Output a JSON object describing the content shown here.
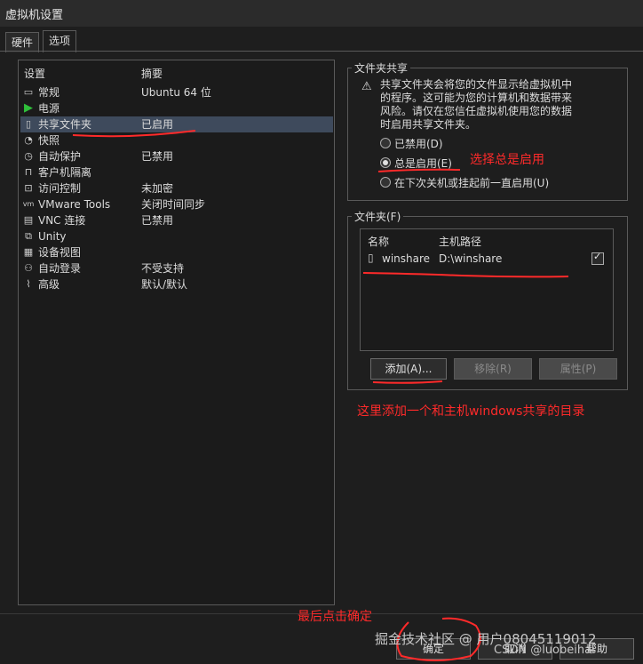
{
  "window": {
    "title": "虚拟机设置"
  },
  "tabs": [
    {
      "label": "硬件"
    },
    {
      "label": "选项"
    }
  ],
  "settings": {
    "col_setting": "设置",
    "col_summary": "摘要",
    "items": [
      {
        "name": "常规",
        "value": "Ubuntu 64 位",
        "icon": "monitor-icon"
      },
      {
        "name": "电源",
        "value": "",
        "icon": "power-play-icon"
      },
      {
        "name": "共享文件夹",
        "value": "已启用",
        "icon": "shared-folder-icon"
      },
      {
        "name": "快照",
        "value": "",
        "icon": "snapshot-icon"
      },
      {
        "name": "自动保护",
        "value": "已禁用",
        "icon": "autoprotect-clock-icon"
      },
      {
        "name": "客户机隔离",
        "value": "",
        "icon": "lock-icon"
      },
      {
        "name": "访问控制",
        "value": "未加密",
        "icon": "access-control-icon"
      },
      {
        "name": "VMware Tools",
        "value": "关闭时间同步",
        "icon": "vmware-tools-icon"
      },
      {
        "name": "VNC 连接",
        "value": "已禁用",
        "icon": "vnc-icon"
      },
      {
        "name": "Unity",
        "value": "",
        "icon": "unity-icon"
      },
      {
        "name": "设备视图",
        "value": "",
        "icon": "device-view-icon"
      },
      {
        "name": "自动登录",
        "value": "不受支持",
        "icon": "autologin-users-icon"
      },
      {
        "name": "高级",
        "value": "默认/默认",
        "icon": "advanced-pulse-icon"
      }
    ]
  },
  "folder_sharing": {
    "title": "文件夹共享",
    "warning_lines": [
      "共享文件夹会将您的文件显示给虚拟机中",
      "的程序。这可能为您的计算机和数据带来",
      "风险。请仅在您信任虚拟机使用您的数据",
      "时启用共享文件夹。"
    ],
    "options": [
      {
        "label": "已禁用(D)",
        "selected": false
      },
      {
        "label": "总是启用(E)",
        "selected": true
      },
      {
        "label": "在下次关机或挂起前一直启用(U)",
        "selected": false
      }
    ]
  },
  "folders": {
    "title": "文件夹(F)",
    "col_name": "名称",
    "col_path": "主机路径",
    "rows": [
      {
        "name": "winshare",
        "path": "D:\\winshare",
        "checked": true
      }
    ],
    "add_label": "添加(A)...",
    "remove_label": "移除(R)",
    "properties_label": "属性(P)"
  },
  "footer": {
    "ok_label": "确定",
    "cancel_label": "取消",
    "help_label": "帮助"
  },
  "annotations": {
    "select_always": "选择总是启用",
    "add_folder": "这里添加一个和主机windows共享的目录",
    "finally_ok": "最后点击确定"
  },
  "watermark": {
    "line1": "掘金技术社区 @ 用户08045119012",
    "line2": "CSDN @luobeihai"
  },
  "colors": {
    "annotation_red": "#ff2a2a",
    "selection": "#3e4a5c",
    "power_green": "#2fbf3a"
  }
}
